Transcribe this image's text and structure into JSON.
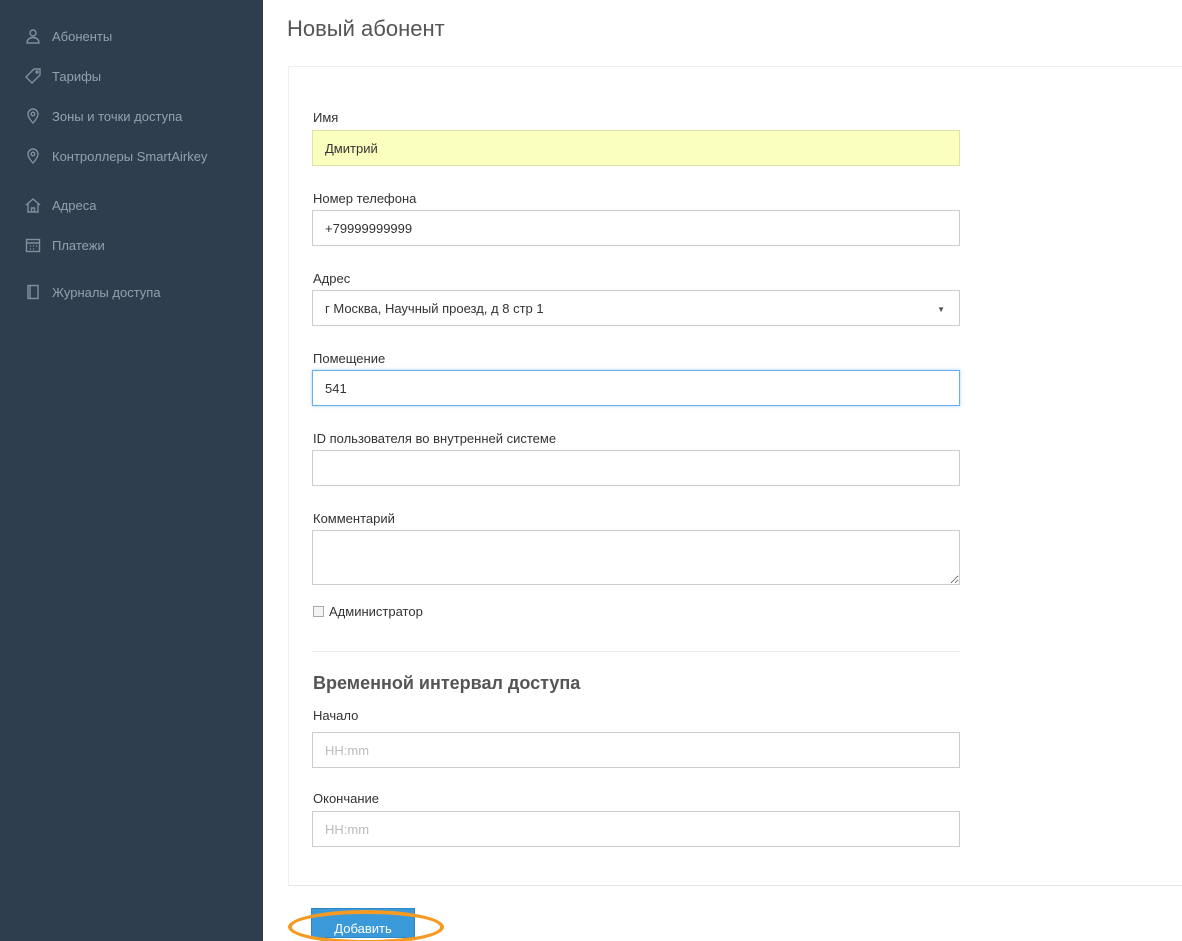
{
  "sidebar": {
    "items": [
      {
        "label": "Абоненты",
        "icon": "user-icon"
      },
      {
        "label": "Тарифы",
        "icon": "tag-icon"
      },
      {
        "label": "Зоны и точки доступа",
        "icon": "location-pin-icon"
      },
      {
        "label": "Контроллеры SmartAirkey",
        "icon": "location-pin-icon"
      },
      {
        "label": "Адреса",
        "icon": "home-icon"
      },
      {
        "label": "Платежи",
        "icon": "calendar-icon"
      },
      {
        "label": "Журналы доступа",
        "icon": "book-icon"
      }
    ]
  },
  "page": {
    "title": "Новый абонент"
  },
  "form": {
    "name_label": "Имя",
    "name_value": "Дмитрий",
    "phone_label": "Номер телефона",
    "phone_value": "+79999999999",
    "address_label": "Адрес",
    "address_value": "г Москва, Научный проезд, д 8 стр 1",
    "room_label": "Помещение",
    "room_value": "541",
    "internal_id_label": "ID пользователя во внутренней системе",
    "internal_id_value": "",
    "comment_label": "Комментарий",
    "comment_value": "",
    "admin_label": "Администратор",
    "admin_checked": false
  },
  "interval": {
    "title": "Временной интервал доступа",
    "start_label": "Начало",
    "start_placeholder": "HH:mm",
    "end_label": "Окончание",
    "end_placeholder": "HH:mm"
  },
  "actions": {
    "add_label": "Добавить"
  },
  "colors": {
    "sidebar_bg": "#2f3e4e",
    "primary": "#3a9ad9",
    "autofill": "#faffbd",
    "highlight": "#f59a23"
  }
}
